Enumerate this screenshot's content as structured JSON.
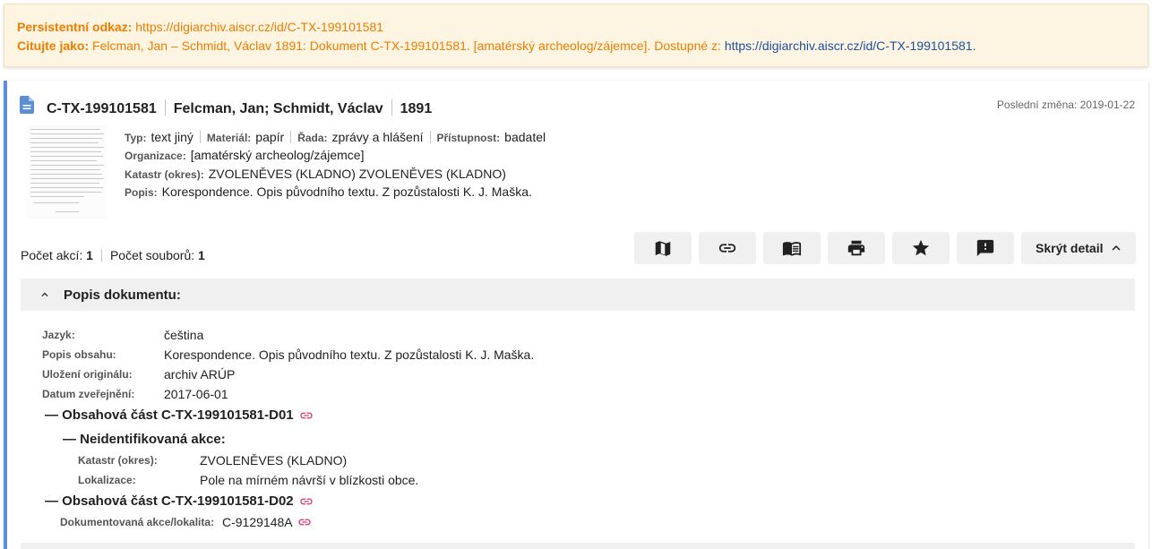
{
  "citation": {
    "persistent_label": "Persistentní odkaz:",
    "persistent_url": "https://digiarchiv.aiscr.cz/id/C-TX-199101581",
    "cite_label": "Citujte jako:",
    "cite_text": "Felcman, Jan – Schmidt, Václav 1891: Dokument C-TX-199101581. [amatérský archeolog/zájemce]. Dostupné z:",
    "cite_url": "https://digiarchiv.aiscr.cz/id/C-TX-199101581",
    "cite_end": "."
  },
  "document": {
    "id": "C-TX-199101581",
    "authors": "Felcman, Jan; Schmidt, Václav",
    "year": "1891",
    "last_change": "Poslední změna: 2019-01-22",
    "type_label": "Typ:",
    "type_value": "text jiný",
    "material_label": "Materiál:",
    "material_value": "papír",
    "series_label": "Řada:",
    "series_value": "zprávy a hlášení",
    "access_label": "Přístupnost:",
    "access_value": "badatel",
    "org_label": "Organizace:",
    "org_value": "[amatérský archeolog/zájemce]",
    "cadastre_label": "Katastr (okres):",
    "cadastre_value": "ZVOLENĚVES  (KLADNO) ZVOLENĚVES  (KLADNO)",
    "desc_label": "Popis:",
    "desc_value": "Korespondence. Opis původního textu. Z pozůstalosti K. J. Maška."
  },
  "counts": {
    "actions_label": "Počet akcí:",
    "actions_value": "1",
    "files_label": "Počet souborů:",
    "files_value": "1"
  },
  "toolbar": {
    "icons": [
      "map-icon",
      "link-icon",
      "book-icon",
      "print-icon",
      "star-icon",
      "feedback-icon"
    ],
    "hide_label": "Skrýt detail"
  },
  "detail": {
    "section_title": "Popis dokumentu:",
    "language_label": "Jazyk:",
    "language_value": "čeština",
    "content_label": "Popis obsahu:",
    "content_value": "Korespondence. Opis původního textu. Z pozůstalosti K. J. Maška.",
    "storage_label": "Uložení originálu:",
    "storage_value": "archiv ARÚP",
    "published_label": "Datum zveřejnění:",
    "published_value": "2017-06-01",
    "part1_title": "— Obsahová část C-TX-199101581-D01",
    "action_title": "— Neidentifikovaná akce:",
    "part1_cadastre_label": "Katastr (okres):",
    "part1_cadastre_value": "ZVOLENĚVES  (KLADNO)",
    "part1_loc_label": "Lokalizace:",
    "part1_loc_value": "Pole na mírném návrší v blízkosti obce.",
    "part2_title": "— Obsahová část C-TX-199101581-D02",
    "part2_action_label": "Dokumentovaná akce/lokalita:",
    "part2_action_value": "C-9129148A"
  },
  "colors": {
    "accent_orange": "#f07d00",
    "link_blue": "#1f4fa3",
    "link_pink": "#e0306b",
    "card_border": "#5a8fd6"
  }
}
